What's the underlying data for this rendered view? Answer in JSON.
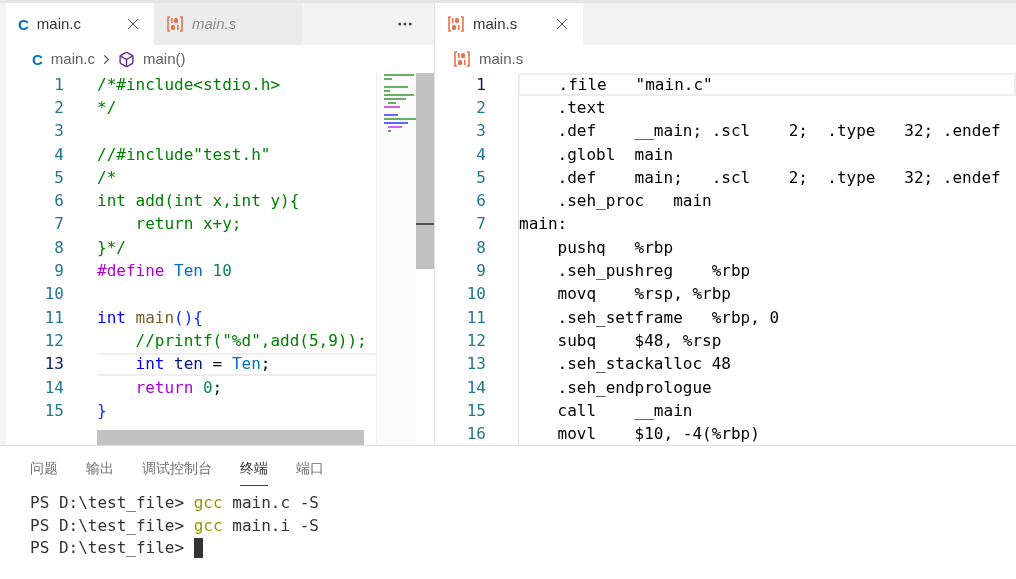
{
  "left_editor": {
    "tabs": [
      {
        "label": "main.c",
        "kind": "c",
        "icon": "C",
        "selected": true,
        "preview": false
      },
      {
        "label": "main.s",
        "kind": "binary",
        "selected": false,
        "preview": true
      }
    ],
    "breadcrumb": {
      "icon": "C",
      "file": "main.c",
      "symbol": "main()"
    },
    "lines": [
      {
        "number": "1",
        "current": false,
        "tokens": [
          {
            "kind": "comment",
            "text": "/*#include<stdio.h>"
          }
        ]
      },
      {
        "number": "2",
        "current": false,
        "tokens": [
          {
            "kind": "comment",
            "text": "*/"
          }
        ]
      },
      {
        "number": "3",
        "current": false
      },
      {
        "number": "4",
        "current": false,
        "tokens": [
          {
            "kind": "comment",
            "text": "//#include\"test.h\""
          }
        ]
      },
      {
        "number": "5",
        "current": false,
        "tokens": [
          {
            "kind": "comment",
            "text": "/*"
          }
        ]
      },
      {
        "number": "6",
        "current": false,
        "tokens": [
          {
            "kind": "comment",
            "text": "int add(int x,int y){"
          }
        ]
      },
      {
        "number": "7",
        "current": false,
        "tokens": [
          {
            "kind": "comment",
            "text": "    return x+y;"
          }
        ]
      },
      {
        "number": "8",
        "current": false,
        "tokens": [
          {
            "kind": "comment",
            "text": "}*/"
          }
        ]
      },
      {
        "number": "9",
        "current": false,
        "tokens": [
          {
            "kind": "macro",
            "text": "#define"
          },
          {
            "kind": "constant",
            "text": " Ten"
          },
          {
            "kind": "number",
            "text": " 10"
          }
        ]
      },
      {
        "number": "10",
        "current": false
      },
      {
        "number": "11",
        "current": false,
        "tokens": [
          {
            "kind": "keyword",
            "text": "int"
          },
          {
            "kind": "function",
            "text": " main"
          },
          {
            "kind": "bracket",
            "text": "(){"
          }
        ]
      },
      {
        "number": "12",
        "current": false,
        "tokens": [
          {
            "kind": "comment",
            "text": "    //printf(\"%d\",add(5,9));"
          }
        ]
      },
      {
        "number": "13",
        "current": true,
        "tokens": [
          {
            "kind": "keyword",
            "text": "    int"
          },
          {
            "kind": "variable",
            "text": " ten"
          },
          {
            "kind": "plain",
            "text": " = "
          },
          {
            "kind": "constant",
            "text": "Ten"
          },
          {
            "kind": "plain",
            "text": ";"
          }
        ]
      },
      {
        "number": "14",
        "current": false,
        "tokens": [
          {
            "kind": "control",
            "text": "    return"
          },
          {
            "kind": "number",
            "text": " 0"
          },
          {
            "kind": "plain",
            "text": ";"
          }
        ]
      },
      {
        "number": "15",
        "current": false,
        "tokens": [
          {
            "kind": "bracket",
            "text": "}"
          }
        ]
      }
    ]
  },
  "right_editor": {
    "tabs": [
      {
        "label": "main.s",
        "kind": "binary",
        "selected": true,
        "preview": false
      }
    ],
    "breadcrumb": {
      "file": "main.s"
    },
    "lines": [
      {
        "number": "1",
        "current": true,
        "text": "    .file   \"main.c\""
      },
      {
        "number": "2",
        "current": false,
        "text": "    .text"
      },
      {
        "number": "3",
        "current": false,
        "text": "    .def    __main; .scl    2;  .type   32; .endef"
      },
      {
        "number": "4",
        "current": false,
        "text": "    .globl  main"
      },
      {
        "number": "5",
        "current": false,
        "text": "    .def    main;   .scl    2;  .type   32; .endef"
      },
      {
        "number": "6",
        "current": false,
        "text": "    .seh_proc   main"
      },
      {
        "number": "7",
        "current": false,
        "text": "main:"
      },
      {
        "number": "8",
        "current": false,
        "text": "    pushq   %rbp"
      },
      {
        "number": "9",
        "current": false,
        "text": "    .seh_pushreg    %rbp"
      },
      {
        "number": "10",
        "current": false,
        "text": "    movq    %rsp, %rbp"
      },
      {
        "number": "11",
        "current": false,
        "text": "    .seh_setframe   %rbp, 0"
      },
      {
        "number": "12",
        "current": false,
        "text": "    subq    $48, %rsp"
      },
      {
        "number": "13",
        "current": false,
        "text": "    .seh_stackalloc 48"
      },
      {
        "number": "14",
        "current": false,
        "text": "    .seh_endprologue"
      },
      {
        "number": "15",
        "current": false,
        "text": "    call    __main"
      },
      {
        "number": "16",
        "current": false,
        "text": "    movl    $10, -4(%rbp)"
      }
    ]
  },
  "panel": {
    "tabs": [
      {
        "label": "问题",
        "selected": false
      },
      {
        "label": "输出",
        "selected": false
      },
      {
        "label": "调试控制台",
        "selected": false
      },
      {
        "label": "终端",
        "selected": true
      },
      {
        "label": "端口",
        "selected": false
      }
    ],
    "terminal": [
      {
        "prompt": "PS D:\\test_file>",
        "command": "gcc",
        "args": "main.c -S",
        "cursor": false
      },
      {
        "prompt": "PS D:\\test_file>",
        "command": "gcc",
        "args": "main.i -S",
        "cursor": false
      },
      {
        "prompt": "PS D:\\test_file>",
        "cursor": true
      }
    ]
  }
}
